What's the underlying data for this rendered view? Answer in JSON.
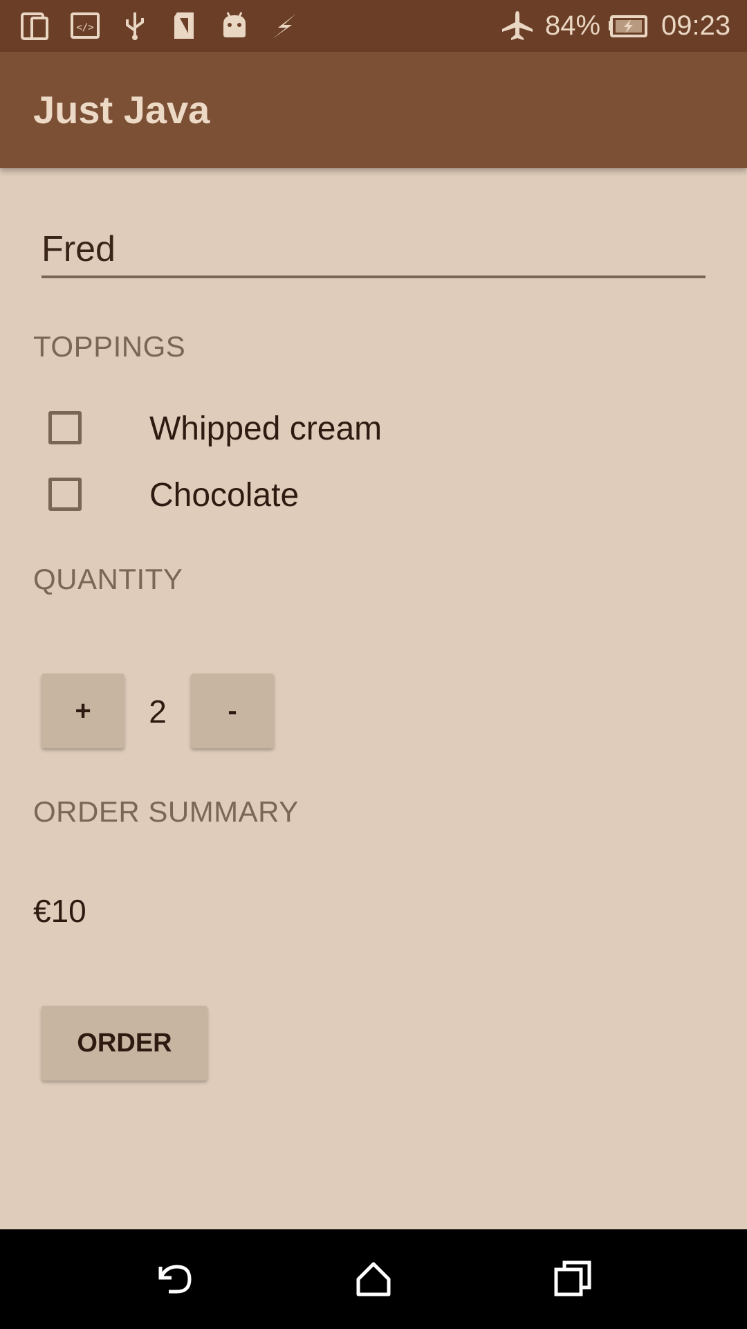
{
  "status_bar": {
    "battery": "84%",
    "time": "09:23",
    "icons": [
      "phone-tablet-icon",
      "code-icon",
      "usb-icon",
      "sd-card-icon",
      "android-debug-icon",
      "flash-icon",
      "airplane-mode-icon",
      "battery-charging-icon"
    ]
  },
  "app_bar": {
    "title": "Just Java"
  },
  "name_field": {
    "value": "Fred"
  },
  "toppings": {
    "header": "TOPPINGS",
    "items": [
      {
        "label": "Whipped cream",
        "checked": false
      },
      {
        "label": "Chocolate",
        "checked": false
      }
    ]
  },
  "quantity": {
    "header": "QUANTITY",
    "increment_label": "+",
    "value": "2",
    "decrement_label": "-"
  },
  "order_summary": {
    "header": "ORDER SUMMARY",
    "price": "€10"
  },
  "order_button": {
    "label": "ORDER"
  },
  "nav_bar": {
    "icons": [
      "back-icon",
      "home-icon",
      "recents-icon"
    ]
  },
  "colors": {
    "status_bar": "#6b3f27",
    "app_bar": "#7c5034",
    "background": "#dfccba",
    "button": "#c8b5a1",
    "text_dark": "#2e1a10",
    "label": "#7a6756"
  }
}
